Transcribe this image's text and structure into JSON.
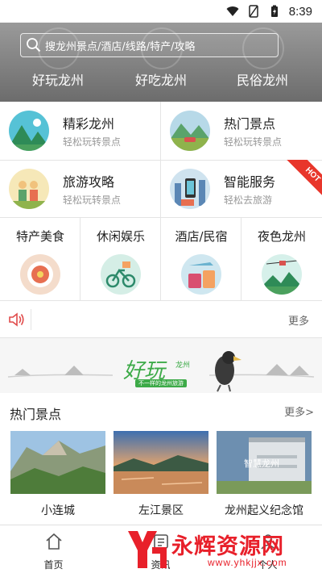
{
  "status": {
    "time": "8:39"
  },
  "header": {
    "search_placeholder": "搜龙州景点/酒店/线路/特产/攻略",
    "nav": [
      "好玩龙州",
      "好吃龙州",
      "民俗龙州"
    ]
  },
  "features": [
    {
      "title": "精彩龙州",
      "sub": "轻松玩转景点"
    },
    {
      "title": "热门景点",
      "sub": "轻松玩转景点"
    },
    {
      "title": "旅游攻略",
      "sub": "轻松玩转景点"
    },
    {
      "title": "智能服务",
      "sub": "轻松去旅游"
    }
  ],
  "hot_badge": "HOT",
  "categories": [
    "特产美食",
    "休闲娱乐",
    "酒店/民宿",
    "夜色龙州"
  ],
  "notice": {
    "more": "更多"
  },
  "banner": {
    "title": "好玩",
    "sub": "龙州",
    "tag": "不一样的龙州旅游"
  },
  "hot_spots": {
    "title": "热门景点",
    "more": "更多>",
    "items": [
      {
        "name": "小连城"
      },
      {
        "name": "左江景区"
      },
      {
        "name": "龙州起义纪念馆",
        "overlay": "智慧龙州"
      }
    ]
  },
  "tabbar": {
    "tabs": [
      "首页",
      "资讯",
      "个人"
    ]
  },
  "watermark": {
    "text": "永辉资源网",
    "url": "www.yhkjjx.com"
  }
}
